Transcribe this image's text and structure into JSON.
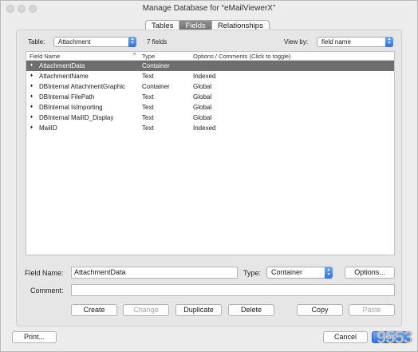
{
  "window": {
    "title": "Manage Database for “eMailViewerX”"
  },
  "tabs": [
    {
      "label": "Tables",
      "active": false
    },
    {
      "label": "Fields",
      "active": true
    },
    {
      "label": "Relationships",
      "active": false
    }
  ],
  "toolbar": {
    "table_label": "Table:",
    "table_value": "Attachment",
    "field_count": "7 fields",
    "view_by_label": "View by:",
    "view_by_value": "field name"
  },
  "list": {
    "columns": {
      "name": "Field Name",
      "type": "Type",
      "options": "Options / Comments   (Click to toggle)"
    },
    "sort_indicator": "^",
    "rows": [
      {
        "name": "AttachmentData",
        "type": "Container",
        "options": "",
        "selected": true
      },
      {
        "name": "AttachmentName",
        "type": "Text",
        "options": "Indexed",
        "selected": false
      },
      {
        "name": "DBInternal AttachmentGraphic",
        "type": "Container",
        "options": "Global",
        "selected": false
      },
      {
        "name": "DBInternal FilePath",
        "type": "Text",
        "options": "Global",
        "selected": false
      },
      {
        "name": "DBInternal IsImporting",
        "type": "Text",
        "options": "Global",
        "selected": false
      },
      {
        "name": "DBInternal MailID_Display",
        "type": "Text",
        "options": "Global",
        "selected": false
      },
      {
        "name": "MailID",
        "type": "Text",
        "options": "Indexed",
        "selected": false
      }
    ]
  },
  "editor": {
    "field_name_label": "Field Name:",
    "field_name_value": "AttachmentData",
    "type_label": "Type:",
    "type_value": "Container",
    "options_button": "Options...",
    "comment_label": "Comment:",
    "comment_value": ""
  },
  "actions": {
    "create": "Create",
    "change": "Change",
    "duplicate": "Duplicate",
    "delete": "Delete",
    "copy": "Copy",
    "paste": "Paste"
  },
  "footer": {
    "print": "Print...",
    "cancel": "Cancel",
    "ok": "OK"
  },
  "watermark": "9553"
}
